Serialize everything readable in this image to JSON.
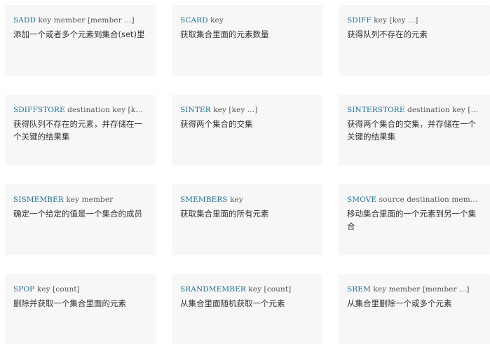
{
  "cards": [
    {
      "command": "SADD",
      "args": "key member [member ...]",
      "description": "添加一个或者多个元素到集合(set)里"
    },
    {
      "command": "SCARD",
      "args": "key",
      "description": "获取集合里面的元素数量"
    },
    {
      "command": "SDIFF",
      "args": "key [key ...]",
      "description": "获得队列不存在的元素"
    },
    {
      "command": "SDIFFSTORE",
      "args": "destination key [k…",
      "description": "获得队列不存在的元素，并存储在一个关键的结果集"
    },
    {
      "command": "SINTER",
      "args": "key [key ...]",
      "description": "获得两个集合的交集"
    },
    {
      "command": "SINTERSTORE",
      "args": "destination key […",
      "description": "获得两个集合的交集，并存储在一个关键的结果集"
    },
    {
      "command": "SISMEMBER",
      "args": "key member",
      "description": "确定一个给定的值是一个集合的成员"
    },
    {
      "command": "SMEMBERS",
      "args": "key",
      "description": "获取集合里面的所有元素"
    },
    {
      "command": "SMOVE",
      "args": "source destination member",
      "description": "移动集合里面的一个元素到另一个集合"
    },
    {
      "command": "SPOP",
      "args": "key [count]",
      "description": "删除并获取一个集合里面的元素"
    },
    {
      "command": "SRANDMEMBER",
      "args": "key [count]",
      "description": "从集合里面随机获取一个元素"
    },
    {
      "command": "SREM",
      "args": "key member [member ...]",
      "description": "从集合里删除一个或多个元素"
    }
  ]
}
